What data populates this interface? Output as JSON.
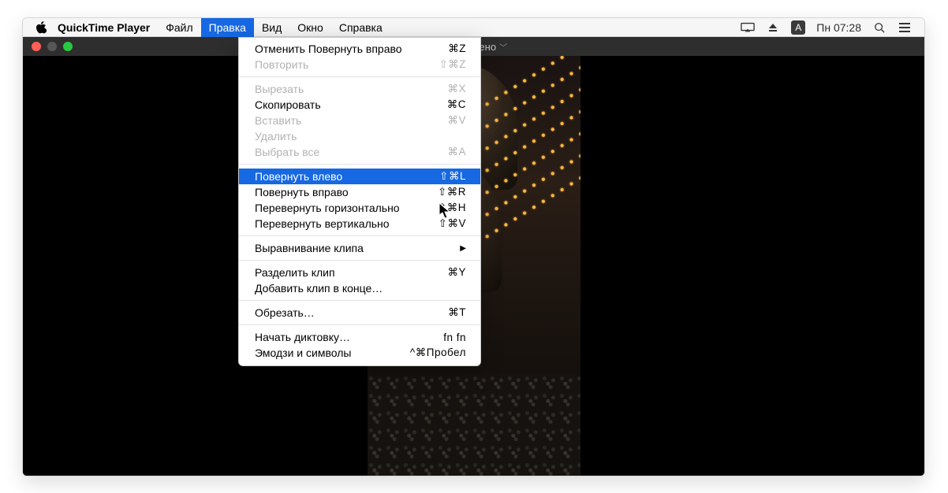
{
  "menubar": {
    "app_name": "QuickTime Player",
    "items": [
      {
        "label": "Файл"
      },
      {
        "label": "Правка",
        "active": true
      },
      {
        "label": "Вид"
      },
      {
        "label": "Окно"
      },
      {
        "label": "Справка"
      }
    ],
    "right": {
      "keyboard_indicator": "А",
      "clock": "Пн 07:28"
    }
  },
  "qt_window": {
    "title_suffix": "– Изменено"
  },
  "dropdown": {
    "sections": [
      [
        {
          "label": "Отменить Повернуть вправо",
          "shortcut": "⌘Z"
        },
        {
          "label": "Повторить",
          "shortcut": "⇧⌘Z",
          "disabled": true
        }
      ],
      [
        {
          "label": "Вырезать",
          "shortcut": "⌘X",
          "disabled": true
        },
        {
          "label": "Скопировать",
          "shortcut": "⌘C"
        },
        {
          "label": "Вставить",
          "shortcut": "⌘V",
          "disabled": true
        },
        {
          "label": "Удалить",
          "shortcut": "",
          "disabled": true
        },
        {
          "label": "Выбрать все",
          "shortcut": "⌘A",
          "disabled": true
        }
      ],
      [
        {
          "label": "Повернуть влево",
          "shortcut": "⇧⌘L",
          "highlight": true
        },
        {
          "label": "Повернуть вправо",
          "shortcut": "⇧⌘R"
        },
        {
          "label": "Перевернуть горизонтально",
          "shortcut": "⇧⌘H"
        },
        {
          "label": "Перевернуть вертикально",
          "shortcut": "⇧⌘V"
        }
      ],
      [
        {
          "label": "Выравнивание клипа",
          "submenu": true
        }
      ],
      [
        {
          "label": "Разделить клип",
          "shortcut": "⌘Y"
        },
        {
          "label": "Добавить клип в конце…",
          "shortcut": ""
        }
      ],
      [
        {
          "label": "Обрезать…",
          "shortcut": "⌘T"
        }
      ],
      [
        {
          "label": "Начать диктовку…",
          "shortcut": "fn fn"
        },
        {
          "label": "Эмодзи и символы",
          "shortcut": "^⌘Пробел"
        }
      ]
    ]
  }
}
